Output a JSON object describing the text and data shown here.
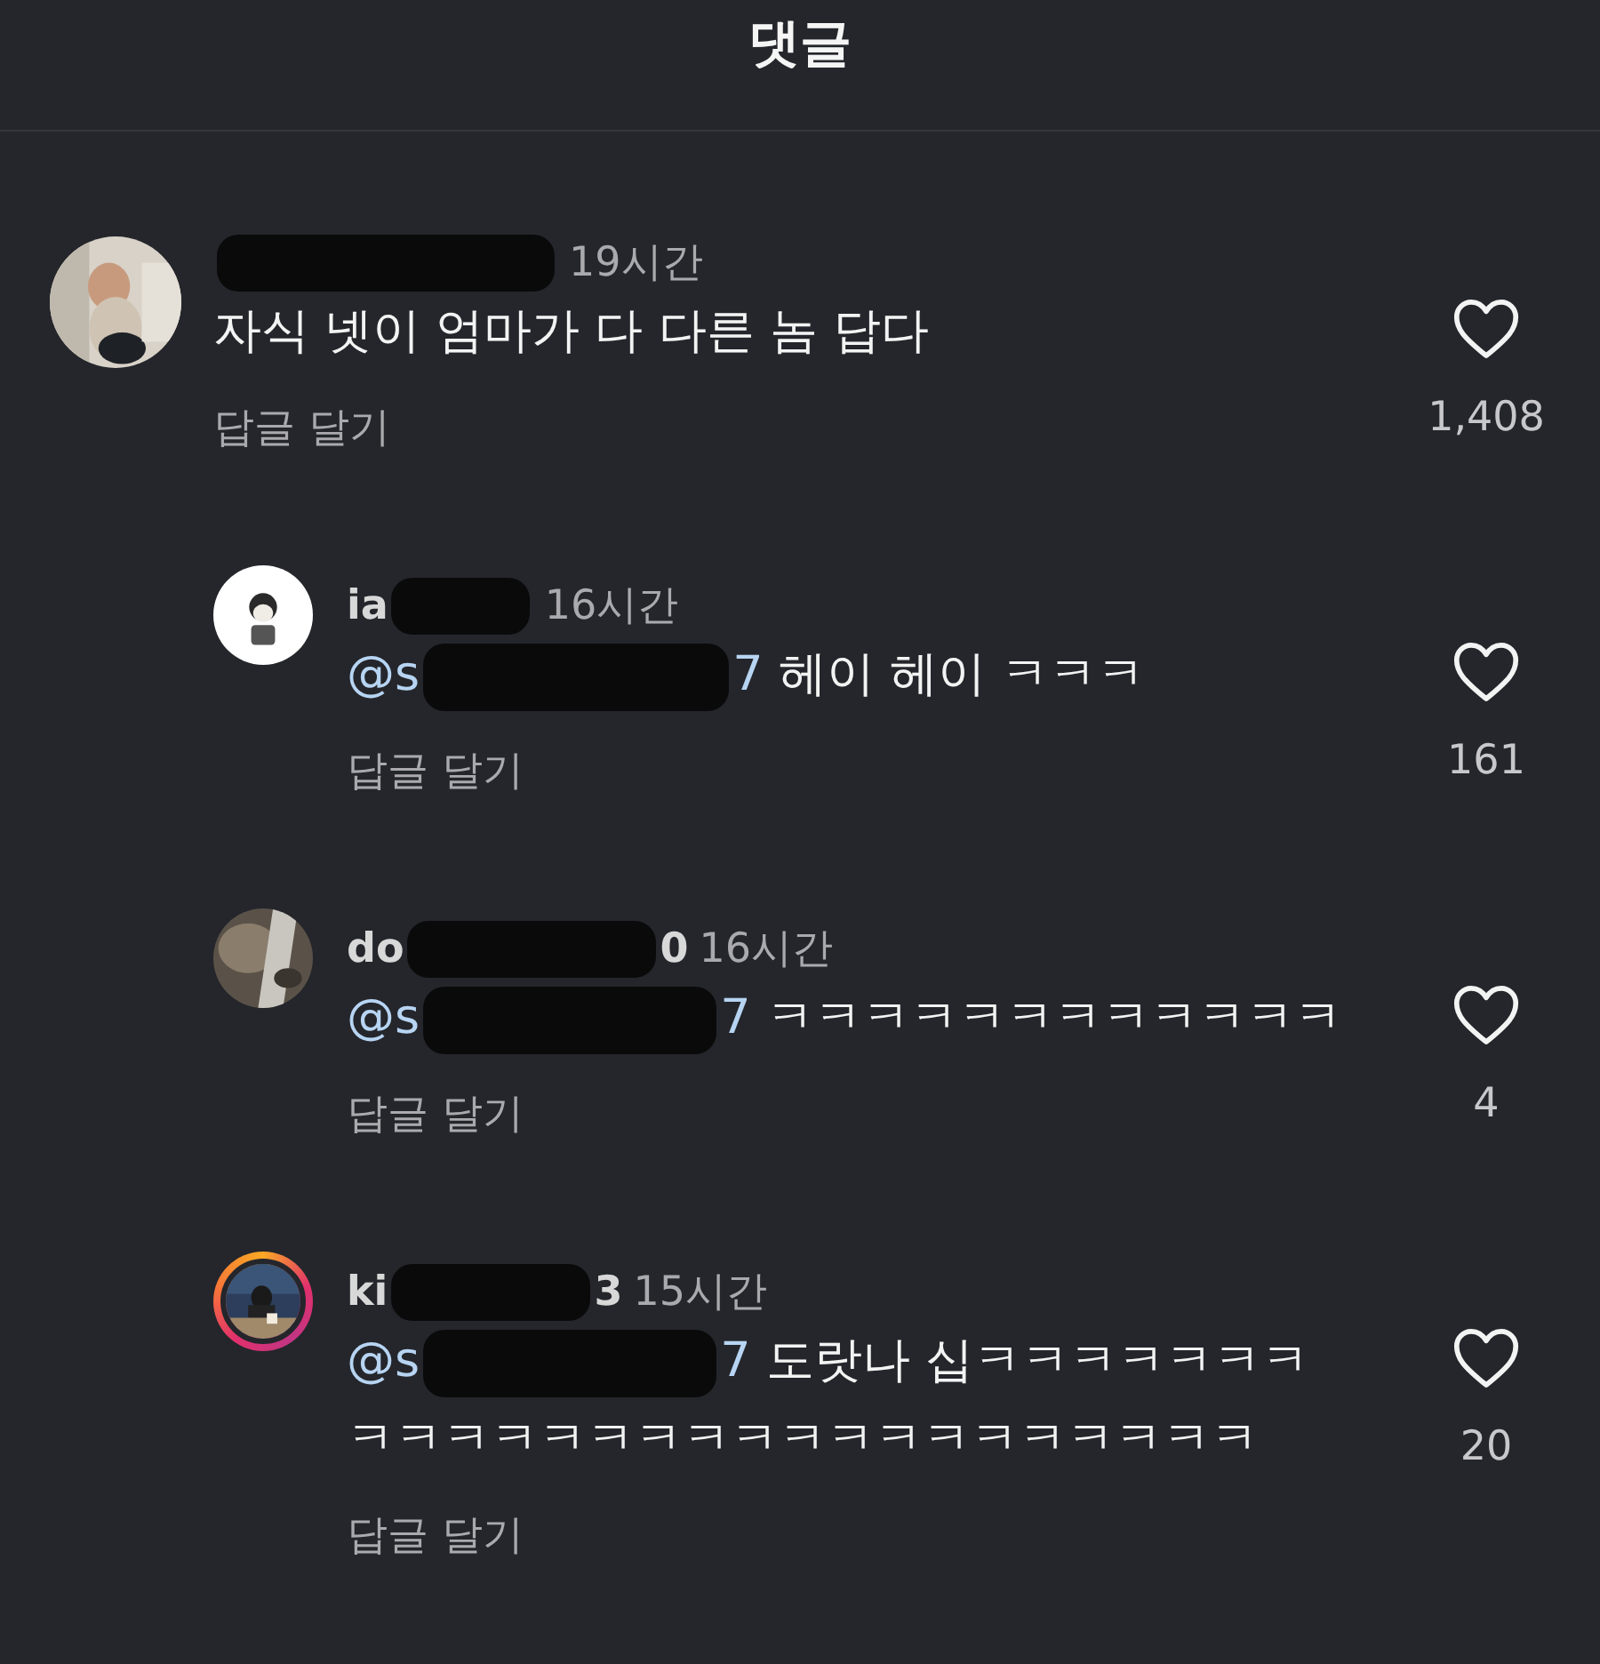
{
  "header": {
    "title": "댓글"
  },
  "comments": [
    {
      "time": "19시간",
      "text": "자식 넷이 엄마가 다 다른 놈 답다",
      "reply_action": "답글 달기",
      "likes": "1,408",
      "story_ring": false,
      "replies": [
        {
          "author_start": "ia",
          "time": "16시간",
          "mention_start": "@s",
          "mention_end": "7",
          "text": "헤이 헤이 ㅋㅋㅋ",
          "reply_action": "답글 달기",
          "likes": "161",
          "story_ring": false
        },
        {
          "author_start": "do",
          "author_end": "0",
          "time": "16시간",
          "mention_start": "@s",
          "mention_end": "7",
          "text": "ㅋㅋㅋㅋㅋㅋㅋㅋㅋㅋㅋㅋ",
          "reply_action": "답글 달기",
          "likes": "4",
          "story_ring": false
        },
        {
          "author_start": "ki",
          "author_end": "3",
          "time": "15시간",
          "mention_start": "@s",
          "mention_end": "7",
          "text": "도랏나 십ㅋㅋㅋㅋㅋㅋㅋㅋㅋㅋㅋㅋㅋㅋㅋㅋㅋㅋㅋㅋㅋㅋㅋㅋㅋㅋ",
          "reply_action": "답글 달기",
          "likes": "20",
          "story_ring": true
        }
      ]
    }
  ]
}
